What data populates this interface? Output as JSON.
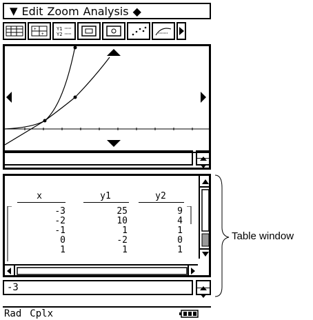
{
  "menubar": {
    "glyph": "▼",
    "items": [
      "Edit",
      "Zoom",
      "Analysis",
      "◆"
    ]
  },
  "toolbar": {
    "buttons": [
      "table-view",
      "split-view",
      "function-list",
      "zoom-box",
      "zoom-fit",
      "plot-points",
      "sketch-dy"
    ]
  },
  "graph": {
    "entry_value": ""
  },
  "table": {
    "headers": [
      "x",
      "y1",
      "y2"
    ],
    "rows": [
      [
        "-3",
        "25",
        "9"
      ],
      [
        "-2",
        "10",
        "4"
      ],
      [
        "-1",
        "1",
        "1"
      ],
      [
        "0",
        "-2",
        "0"
      ],
      [
        "1",
        "1",
        "1"
      ]
    ],
    "entry_value": "-3"
  },
  "status": {
    "mode": "Rad",
    "complex": "Cplx"
  },
  "annotation": {
    "label": "Table window"
  }
}
